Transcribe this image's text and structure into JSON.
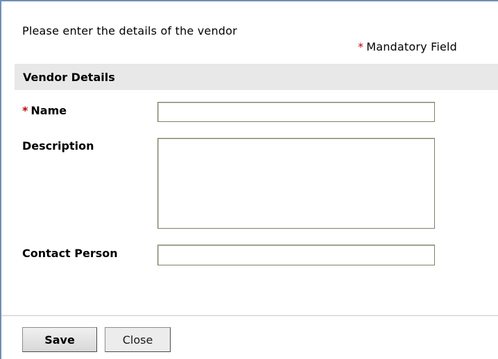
{
  "form": {
    "intro_text": "Please enter the details of the vendor",
    "mandatory_marker": "*",
    "mandatory_note": "Mandatory Field",
    "section_title": "Vendor Details",
    "fields": {
      "name": {
        "label": "Name",
        "value": "",
        "required": true
      },
      "description": {
        "label": "Description",
        "value": ""
      },
      "contact_person": {
        "label": "Contact Person",
        "value": ""
      }
    }
  },
  "actions": {
    "save_label": "Save",
    "close_label": "Close"
  },
  "colors": {
    "required_marker": "#c00000",
    "section_background": "#e8e8e8",
    "frame_border": "#6f8fb3"
  }
}
